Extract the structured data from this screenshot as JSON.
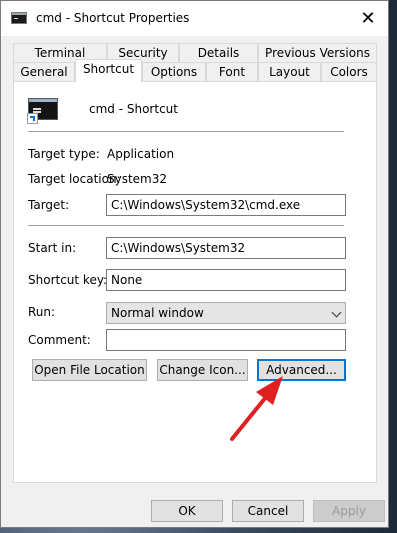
{
  "window": {
    "title": "cmd - Shortcut Properties",
    "close_glyph": "✕"
  },
  "tabs": {
    "row1": [
      "Terminal",
      "Security",
      "Details",
      "Previous Versions"
    ],
    "row2": [
      "General",
      "Shortcut",
      "Options",
      "Font",
      "Layout",
      "Colors"
    ],
    "active": "Shortcut"
  },
  "shortcut": {
    "name": "cmd - Shortcut",
    "target_type_label": "Target type:",
    "target_type": "Application",
    "target_location_label": "Target location:",
    "target_location": "System32",
    "target_label": "Target:",
    "target": "C:\\Windows\\System32\\cmd.exe",
    "start_in_label": "Start in:",
    "start_in": "C:\\Windows\\System32",
    "shortcut_key_label": "Shortcut key:",
    "shortcut_key": "None",
    "run_label": "Run:",
    "run": "Normal window",
    "comment_label": "Comment:",
    "comment": ""
  },
  "buttons": {
    "open_file_location": "Open File Location",
    "change_icon": "Change Icon...",
    "advanced": "Advanced...",
    "ok": "OK",
    "cancel": "Cancel",
    "apply": "Apply"
  },
  "colors": {
    "annotation_arrow": "#e02020",
    "focus_blue": "#0078d7"
  },
  "icons": [
    "console-icon",
    "shortcut-overlay-icon",
    "close-icon",
    "chevron-down-icon",
    "red-arrow-annotation"
  ]
}
